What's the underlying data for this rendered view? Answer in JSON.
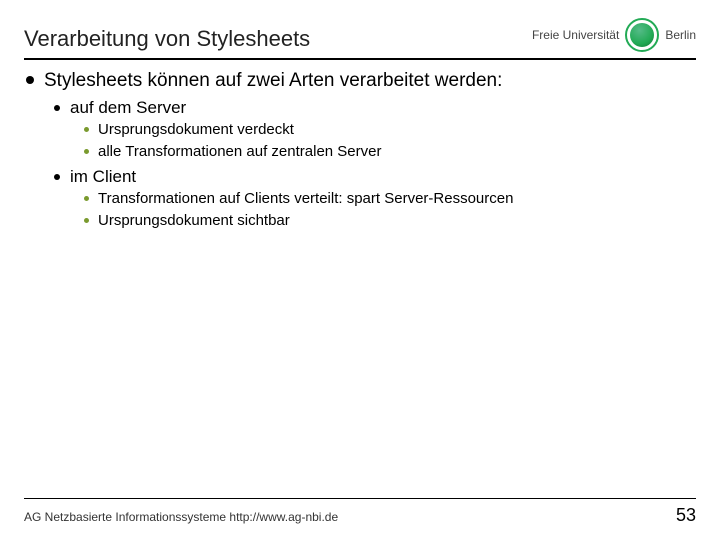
{
  "header": {
    "title": "Verarbeitung von Stylesheets",
    "logo": {
      "left_text": "Freie Universität",
      "right_text": "Berlin",
      "seal_name": "fu-berlin-seal"
    }
  },
  "body": {
    "l1": "Stylesheets können auf zwei Arten verarbeitet werden:",
    "sec1": {
      "title": "auf dem Server",
      "items": [
        "Ursprungsdokument verdeckt",
        "alle Transformationen auf zentralen Server"
      ]
    },
    "sec2": {
      "title": "im Client",
      "items": [
        "Transformationen auf Clients verteilt: spart Server-Ressourcen",
        "Ursprungsdokument sichtbar"
      ]
    }
  },
  "footer": {
    "text": "AG Netzbasierte Informationssysteme http://www.ag-nbi.de",
    "page": "53"
  }
}
